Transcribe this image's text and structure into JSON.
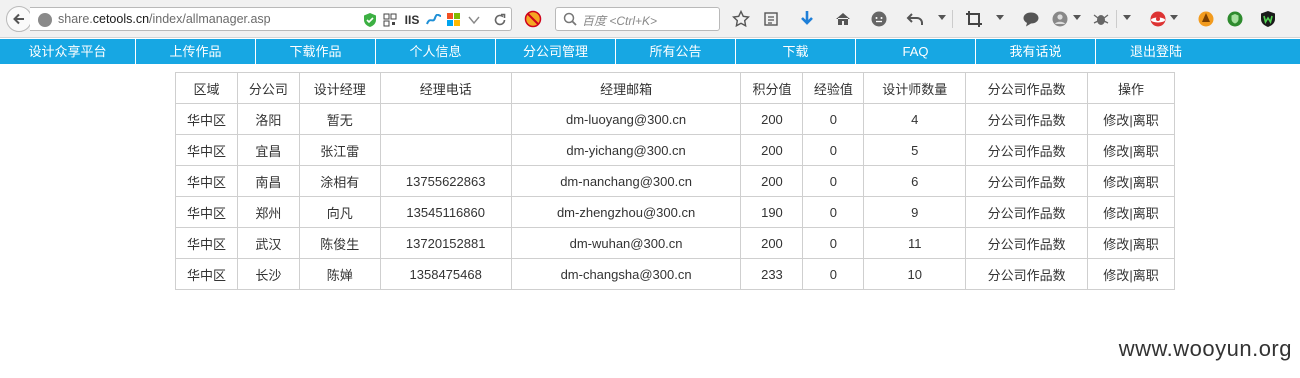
{
  "browser": {
    "url_prefix": "share.",
    "url_host": "cetools.cn",
    "url_path": "/index/allmanager.asp",
    "iis_label": "IIS",
    "search_placeholder": "百度 <Ctrl+K>"
  },
  "nav": {
    "items": [
      {
        "label": "设计众享平台"
      },
      {
        "label": "上传作品"
      },
      {
        "label": "下载作品"
      },
      {
        "label": "个人信息"
      },
      {
        "label": "分公司管理"
      },
      {
        "label": "所有公告"
      },
      {
        "label": "下载"
      },
      {
        "label": "FAQ"
      },
      {
        "label": "我有话说"
      },
      {
        "label": "退出登陆"
      }
    ]
  },
  "table": {
    "headers": [
      "区域",
      "分公司",
      "设计经理",
      "经理电话",
      "经理邮箱",
      "积分值",
      "经验值",
      "设计师数量",
      "分公司作品数",
      "操作"
    ],
    "rows": [
      {
        "region": "华中区",
        "branch": "洛阳",
        "manager": "暂无",
        "phone": "",
        "email": "dm-luoyang@300.cn",
        "points": "200",
        "exp": "0",
        "designers": "4",
        "works_link": "分公司作品数",
        "edit": "修改",
        "sep": "|",
        "resign": "离职"
      },
      {
        "region": "华中区",
        "branch": "宜昌",
        "manager": "张江雷",
        "phone": "",
        "email": "dm-yichang@300.cn",
        "points": "200",
        "exp": "0",
        "designers": "5",
        "works_link": "分公司作品数",
        "edit": "修改",
        "sep": "|",
        "resign": "离职"
      },
      {
        "region": "华中区",
        "branch": "南昌",
        "manager": "涂相有",
        "phone": "13755622863",
        "email": "dm-nanchang@300.cn",
        "points": "200",
        "exp": "0",
        "designers": "6",
        "works_link": "分公司作品数",
        "edit": "修改",
        "sep": "|",
        "resign": "离职"
      },
      {
        "region": "华中区",
        "branch": "郑州",
        "manager": "向凡",
        "phone": "13545116860",
        "email": "dm-zhengzhou@300.cn",
        "points": "190",
        "exp": "0",
        "designers": "9",
        "works_link": "分公司作品数",
        "edit": "修改",
        "sep": "|",
        "resign": "离职"
      },
      {
        "region": "华中区",
        "branch": "武汉",
        "manager": "陈俊生",
        "phone": "13720152881",
        "email": "dm-wuhan@300.cn",
        "points": "200",
        "exp": "0",
        "designers": "11",
        "works_link": "分公司作品数",
        "edit": "修改",
        "sep": "|",
        "resign": "离职"
      },
      {
        "region": "华中区",
        "branch": "长沙",
        "manager": "陈婵",
        "phone": "1358475468",
        "email": "dm-changsha@300.cn",
        "points": "233",
        "exp": "0",
        "designers": "10",
        "works_link": "分公司作品数",
        "edit": "修改",
        "sep": "|",
        "resign": "离职"
      }
    ]
  },
  "watermark": "www.wooyun.org",
  "colors": {
    "nav_bg": "#17a7e3",
    "nav_text": "#ffffff",
    "border": "#cfcfcf"
  }
}
